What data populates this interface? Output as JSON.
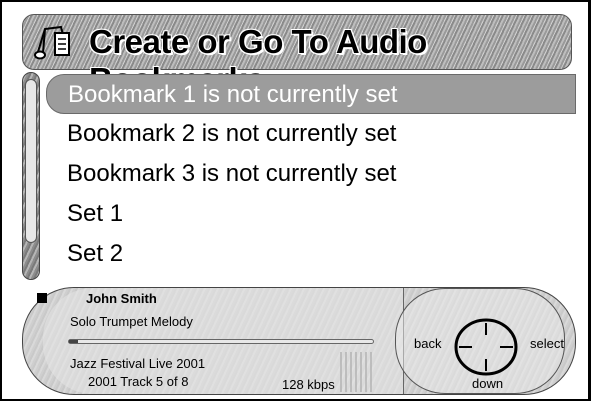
{
  "header": {
    "title": "Create or Go To  Audio Bookmarks",
    "icon": "music-notes-icon"
  },
  "menu": {
    "items": [
      {
        "label": "Bookmark 1 is not currently set",
        "selected": true
      },
      {
        "label": "Bookmark 2 is not currently set",
        "selected": false
      },
      {
        "label": "Bookmark 3 is not currently set",
        "selected": false
      },
      {
        "label": "Set 1",
        "selected": false
      },
      {
        "label": "Set 2",
        "selected": false
      }
    ]
  },
  "player": {
    "status_icon": "stop-icon",
    "artist": "John Smith",
    "track_title": "Solo Trumpet Melody",
    "album": "Jazz Festival Live 2001",
    "track_info": "2001  Track 5 of 8",
    "bitrate": "128 kbps",
    "progress": 0.03
  },
  "controls": {
    "back": "back",
    "select": "select",
    "down": "down",
    "dial_icon": "navigation-dial-icon"
  },
  "colors": {
    "selected_bg": "#9c9c9c",
    "selected_text": "#ffffff"
  }
}
